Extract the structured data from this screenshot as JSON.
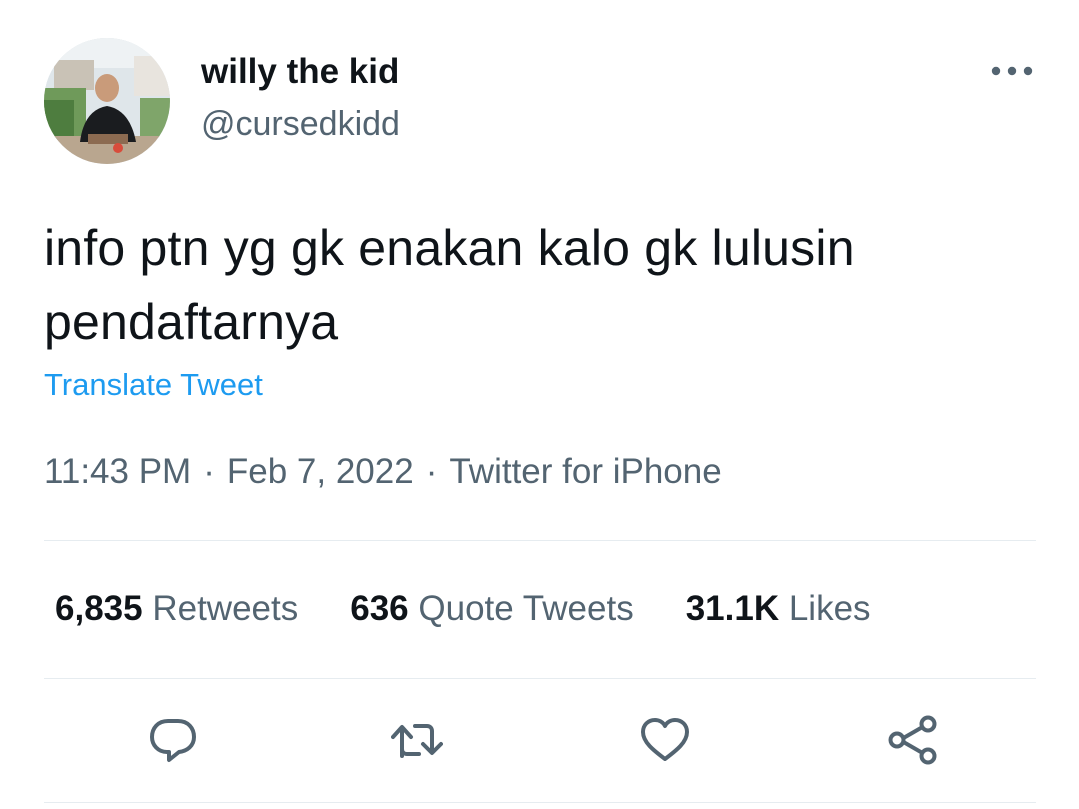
{
  "author": {
    "display_name": "willy the kid",
    "handle": "@cursedkidd"
  },
  "tweet": {
    "text": "info ptn yg gk enakan kalo gk lulusin pendaftarnya",
    "translate_label": "Translate Tweet",
    "time": "11:43 PM",
    "date": "Feb 7, 2022",
    "source": "Twitter for iPhone",
    "separator": "·"
  },
  "stats": {
    "retweets_count": "6,835",
    "retweets_label": "Retweets",
    "quotes_count": "636",
    "quotes_label": "Quote Tweets",
    "likes_count": "31.1K",
    "likes_label": "Likes"
  },
  "icons": {
    "more": "more-horizontal-icon",
    "reply": "reply-icon",
    "retweet": "retweet-icon",
    "like": "heart-icon",
    "share": "share-icon"
  },
  "colors": {
    "text_primary": "#0f1419",
    "text_secondary": "#536471",
    "link": "#1d9bf0",
    "divider": "#e6ecf0"
  }
}
